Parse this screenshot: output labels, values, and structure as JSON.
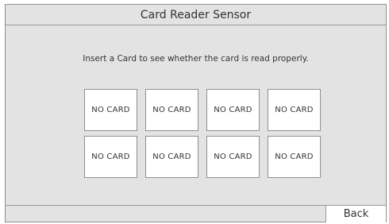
{
  "window": {
    "title": "Card Reader Sensor"
  },
  "main": {
    "instruction": "Insert a Card to see whether the card is read properly.",
    "slots": [
      {
        "status": "NO CARD"
      },
      {
        "status": "NO CARD"
      },
      {
        "status": "NO CARD"
      },
      {
        "status": "NO CARD"
      },
      {
        "status": "NO CARD"
      },
      {
        "status": "NO CARD"
      },
      {
        "status": "NO CARD"
      },
      {
        "status": "NO CARD"
      }
    ]
  },
  "footer": {
    "back_label": "Back"
  }
}
